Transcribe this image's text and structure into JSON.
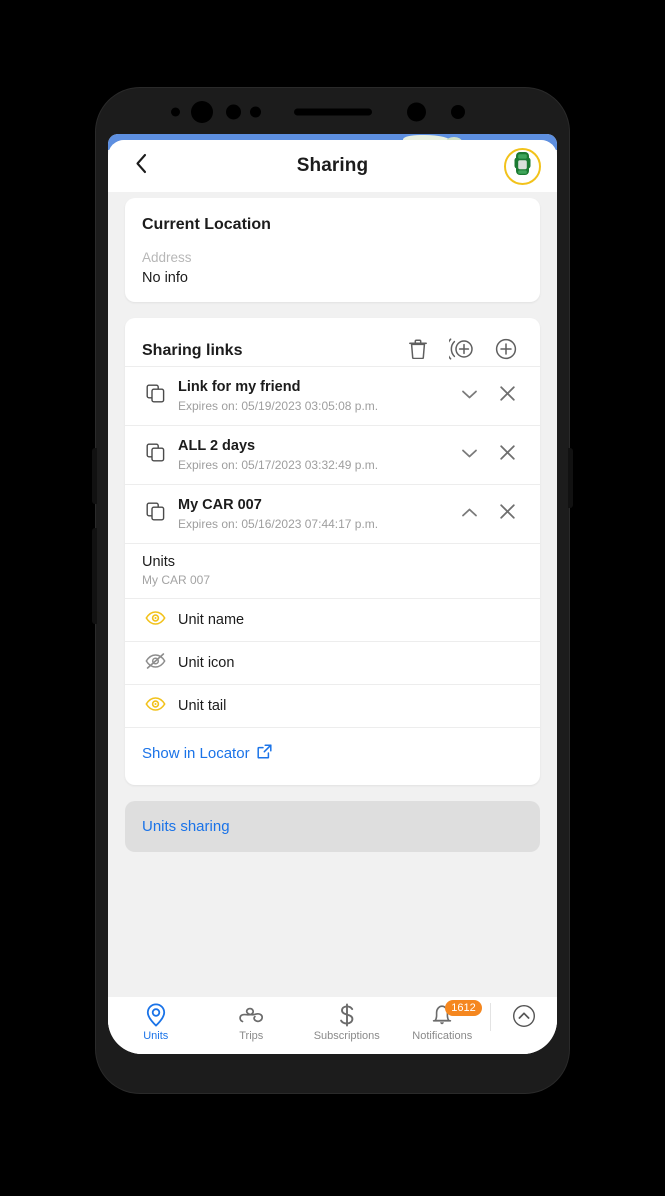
{
  "nav": {
    "back_icon": "chevron-left-icon",
    "title": "Sharing",
    "avatar_icon": "green-car-icon"
  },
  "current_location": {
    "title": "Current Location",
    "address_label": "Address",
    "address_value": "No info"
  },
  "sharing_links": {
    "title": "Sharing links",
    "actions": [
      {
        "name": "delete-links-button",
        "icon": "trash-icon"
      },
      {
        "name": "add-broadcast-link-button",
        "icon": "broadcast-add-icon"
      },
      {
        "name": "add-link-button",
        "icon": "plus-circle-icon"
      }
    ],
    "items": [
      {
        "name": "Link for my friend",
        "expires": "Expires on: 05/19/2023 03:05:08 p.m.",
        "expanded": false,
        "copy_icon": "copy-icon",
        "toggle_icon": "chevron-down-icon",
        "close_icon": "close-icon"
      },
      {
        "name": "ALL 2 days",
        "expires": "Expires on: 05/17/2023 03:32:49 p.m.",
        "expanded": false,
        "copy_icon": "copy-icon",
        "toggle_icon": "chevron-down-icon",
        "close_icon": "close-icon"
      },
      {
        "name": "My CAR 007",
        "expires": "Expires on: 05/16/2023 07:44:17 p.m.",
        "expanded": true,
        "copy_icon": "copy-icon",
        "toggle_icon": "chevron-up-icon",
        "close_icon": "close-icon"
      }
    ],
    "detail": {
      "units_label": "Units",
      "units_value": "My CAR 007",
      "options": [
        {
          "label": "Unit name",
          "visible": true,
          "icon": "eye-icon"
        },
        {
          "label": "Unit icon",
          "visible": false,
          "icon": "eye-off-icon"
        },
        {
          "label": "Unit tail",
          "visible": true,
          "icon": "eye-icon"
        }
      ],
      "locator_link": "Show in Locator",
      "locator_link_icon": "external-link-icon"
    }
  },
  "units_sharing": {
    "label": "Units sharing"
  },
  "tab_bar": {
    "items": [
      {
        "label": "Units",
        "icon": "location-pin-icon",
        "active": true,
        "badge": ""
      },
      {
        "label": "Trips",
        "icon": "route-icon",
        "active": false,
        "badge": ""
      },
      {
        "label": "Subscriptions",
        "icon": "dollar-icon",
        "active": false,
        "badge": ""
      },
      {
        "label": "Notifications",
        "icon": "bell-icon",
        "active": false,
        "badge": "1612"
      }
    ],
    "expand_button_icon": "chevron-up-circle-icon"
  },
  "colors": {
    "accent_blue": "#1a73e8",
    "badge_orange": "#f5871f",
    "eye_yellow": "#f2c21b",
    "screen_bg": "#f1f1f1",
    "card_bg": "#ffffff",
    "units_sharing_bg": "#dedede",
    "map_water": "#5d8fe0"
  }
}
